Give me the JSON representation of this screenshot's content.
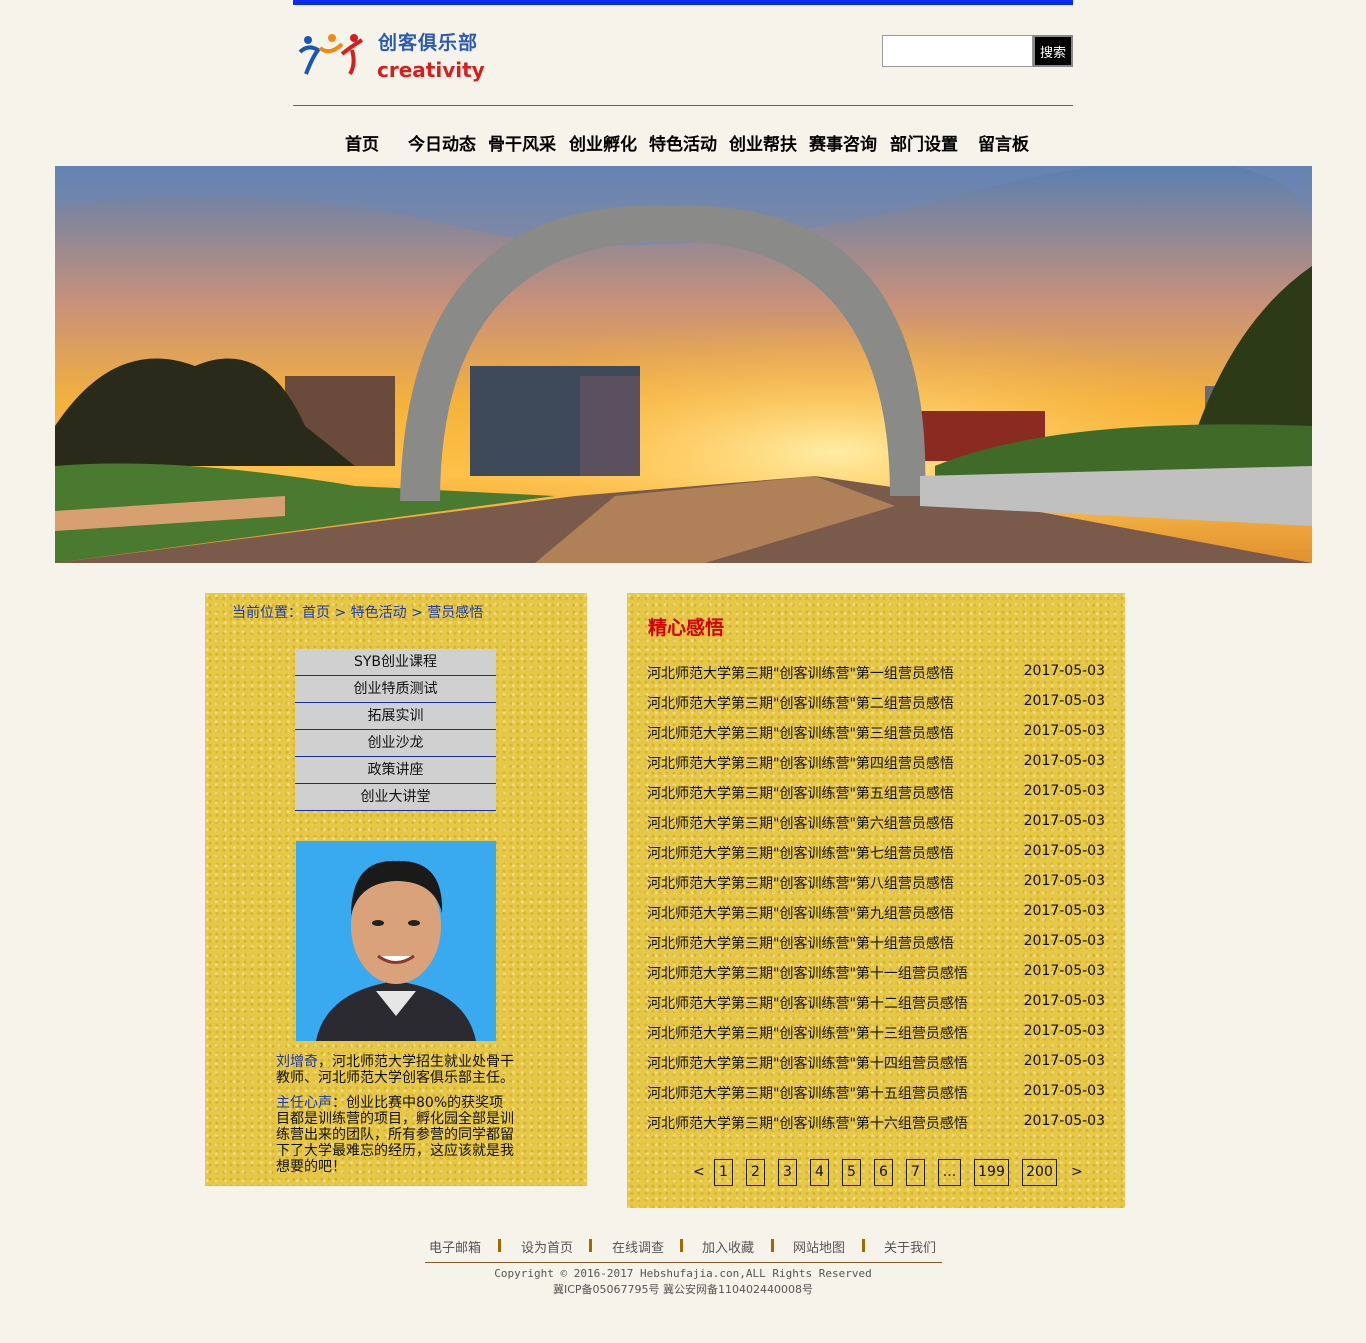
{
  "header": {
    "logo_cn": "创客俱乐部",
    "logo_en": "creativity",
    "search_button": "搜索",
    "search_value": ""
  },
  "nav": [
    "首页",
    "今日动态",
    "骨干风采",
    "创业孵化",
    "特色活动",
    "创业帮扶",
    "赛事咨询",
    "部门设置",
    "留言板"
  ],
  "breadcrumb": {
    "prefix": "当前位置：",
    "home": "首页",
    "sep": " > ",
    "section": "特色活动",
    "current": "营员感悟"
  },
  "side_menu": [
    "SYB创业课程",
    "创业特质测试",
    "拓展实训",
    "创业沙龙",
    "政策讲座",
    "创业大讲堂"
  ],
  "bio": {
    "name": "刘增奇",
    "intro": "，河北师范大学招生就业处骨干教师、河北师范大学创客俱乐部主任。",
    "voice_label": "主任心声",
    "voice": "：创业比赛中80%的获奖项目都是训练营的项目，孵化园全部是训练营出来的团队，所有参营的同学都留下了大学最难忘的经历，这应该就是我想要的吧！"
  },
  "article_section": {
    "title": "精心感悟",
    "articles": [
      {
        "title": "河北师范大学第三期\"创客训练营\"第一组营员感悟",
        "date": "2017-05-03"
      },
      {
        "title": "河北师范大学第三期\"创客训练营\"第二组营员感悟",
        "date": "2017-05-03"
      },
      {
        "title": "河北师范大学第三期\"创客训练营\"第三组营员感悟",
        "date": "2017-05-03"
      },
      {
        "title": "河北师范大学第三期\"创客训练营\"第四组营员感悟",
        "date": "2017-05-03"
      },
      {
        "title": "河北师范大学第三期\"创客训练营\"第五组营员感悟",
        "date": "2017-05-03"
      },
      {
        "title": "河北师范大学第三期\"创客训练营\"第六组营员感悟",
        "date": "2017-05-03"
      },
      {
        "title": "河北师范大学第三期\"创客训练营\"第七组营员感悟",
        "date": "2017-05-03"
      },
      {
        "title": "河北师范大学第三期\"创客训练营\"第八组营员感悟",
        "date": "2017-05-03"
      },
      {
        "title": "河北师范大学第三期\"创客训练营\"第九组营员感悟",
        "date": "2017-05-03"
      },
      {
        "title": "河北师范大学第三期\"创客训练营\"第十组营员感悟",
        "date": "2017-05-03"
      },
      {
        "title": "河北师范大学第三期\"创客训练营\"第十一组营员感悟",
        "date": "2017-05-03"
      },
      {
        "title": "河北师范大学第三期\"创客训练营\"第十二组营员感悟",
        "date": "2017-05-03"
      },
      {
        "title": "河北师范大学第三期\"创客训练营\"第十三组营员感悟",
        "date": "2017-05-03"
      },
      {
        "title": "河北师范大学第三期\"创客训练营\"第十四组营员感悟",
        "date": "2017-05-03"
      },
      {
        "title": "河北师范大学第三期\"创客训练营\"第十五组营员感悟",
        "date": "2017-05-03"
      },
      {
        "title": "河北师范大学第三期\"创客训练营\"第十六组营员感悟",
        "date": "2017-05-03"
      }
    ]
  },
  "pagination": {
    "prev": "<",
    "pages": [
      "1",
      "2",
      "3",
      "4",
      "5",
      "6",
      "7",
      "...",
      "199",
      "200"
    ],
    "next": ">"
  },
  "footer": {
    "links": [
      "电子邮箱",
      "设为首页",
      "在线调查",
      "加入收藏",
      "网站地图",
      "关于我们"
    ],
    "copyright": "Copyright  ©  2016-2017  Hebshufajia.con,ALL  Rights  Reserved",
    "icp": "冀ICP备05067795号   冀公安网备110402440008号"
  },
  "colors": {
    "top_bar": "#0a2bf0",
    "panel": "#e7c746",
    "link_blue": "#1c3aa8",
    "title_red": "#d40000"
  }
}
